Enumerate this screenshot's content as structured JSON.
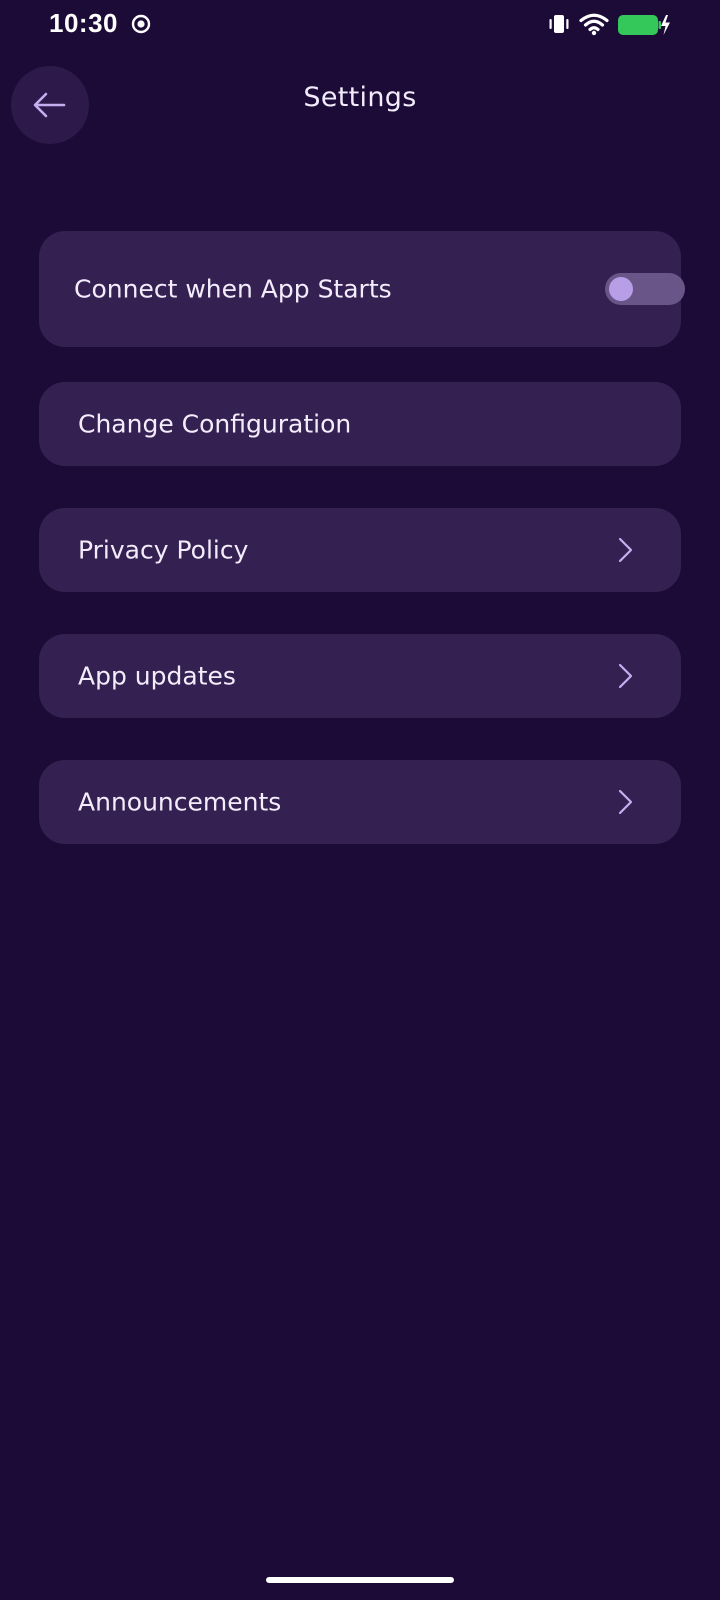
{
  "status_bar": {
    "time": "10:30",
    "icons": [
      "record-icon",
      "vibrate-icon",
      "wifi-icon",
      "battery-charging-icon"
    ],
    "battery_color": "#34c759"
  },
  "header": {
    "back_icon": "arrow-left-icon",
    "title": "Settings"
  },
  "settings": {
    "items": [
      {
        "label": "Connect when App Starts",
        "control": "toggle",
        "toggle_on": false
      },
      {
        "label": "Change Configuration",
        "control": "none"
      },
      {
        "label": "Privacy Policy",
        "control": "chevron-right-icon"
      },
      {
        "label": "App updates",
        "control": "chevron-right-icon"
      },
      {
        "label": "Announcements",
        "control": "chevron-right-icon"
      }
    ]
  },
  "colors": {
    "background": "#1b0b36",
    "card": "#352052",
    "accent": "#b89ee6"
  }
}
